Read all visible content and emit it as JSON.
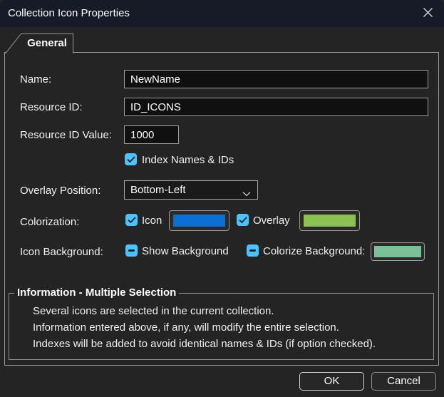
{
  "window": {
    "title": "Collection Icon Properties"
  },
  "tabs": [
    {
      "label": "General"
    }
  ],
  "form": {
    "name": {
      "label": "Name:",
      "value": "NewName"
    },
    "resource_id": {
      "label": "Resource ID:",
      "value": "ID_ICONS"
    },
    "resource_id_value": {
      "label": "Resource ID Value:",
      "value": "1000"
    },
    "index_names": {
      "label": "Index Names & IDs",
      "checked": true
    },
    "overlay_position": {
      "label": "Overlay Position:",
      "value": "Bottom-Left"
    },
    "colorization": {
      "label": "Colorization:",
      "icon": {
        "label": "Icon",
        "checked": true
      },
      "overlay": {
        "label": "Overlay",
        "checked": true
      }
    },
    "icon_background": {
      "label": "Icon Background:",
      "show": {
        "label": "Show Background",
        "state": "indeterminate"
      },
      "colorize": {
        "label": "Colorize Background:",
        "state": "indeterminate"
      }
    }
  },
  "info_group": {
    "title": "Information - Multiple Selection",
    "lines": [
      "Several icons are selected in the current collection.",
      "Information entered above, if any, will modify the entire selection.",
      "Indexes will be added to avoid identical names & IDs (if option checked)."
    ]
  },
  "buttons": {
    "ok": "OK",
    "cancel": "Cancel"
  },
  "colors": {
    "accent_checkbox": "#4cc2ff",
    "icon_swatch": "#0b6fd4",
    "overlay_swatch": "#8cc152",
    "background_swatch": "#79c096",
    "titlebar_bg": "#171b27",
    "dialog_bg": "#242424"
  }
}
